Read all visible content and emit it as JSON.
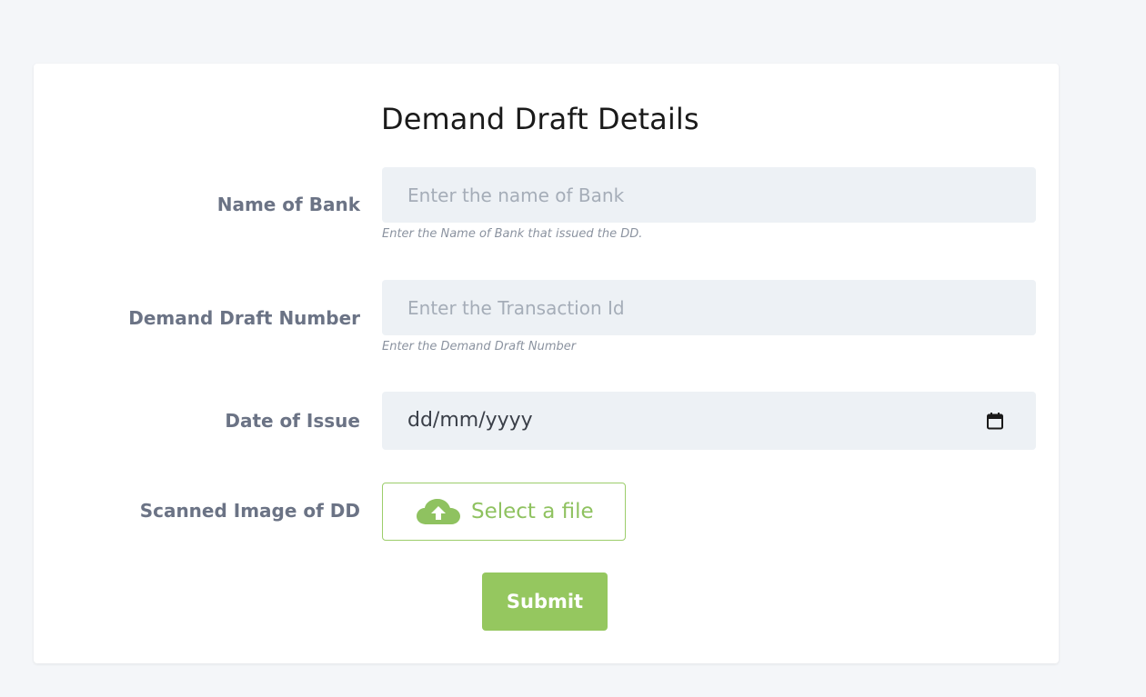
{
  "form": {
    "title": "Demand Draft Details",
    "bank": {
      "label": "Name of Bank",
      "placeholder": "Enter the name of Bank",
      "hint": "Enter the Name of Bank that issued the DD."
    },
    "dd_number": {
      "label": "Demand Draft Number",
      "placeholder": "Enter the Transaction Id",
      "hint": "Enter the Demand Draft Number"
    },
    "date": {
      "label": "Date of Issue",
      "value": "dd/mm/yyyy",
      "icon": "calendar-icon"
    },
    "scan": {
      "label": "Scanned Image of DD",
      "button_label": "Select a file",
      "icon": "cloud-upload-icon"
    },
    "submit_label": "Submit"
  },
  "colors": {
    "accent_green": "#95c75f",
    "label_gray": "#6b7385",
    "input_bg": "#edf1f5",
    "page_bg": "#f4f6f9"
  }
}
